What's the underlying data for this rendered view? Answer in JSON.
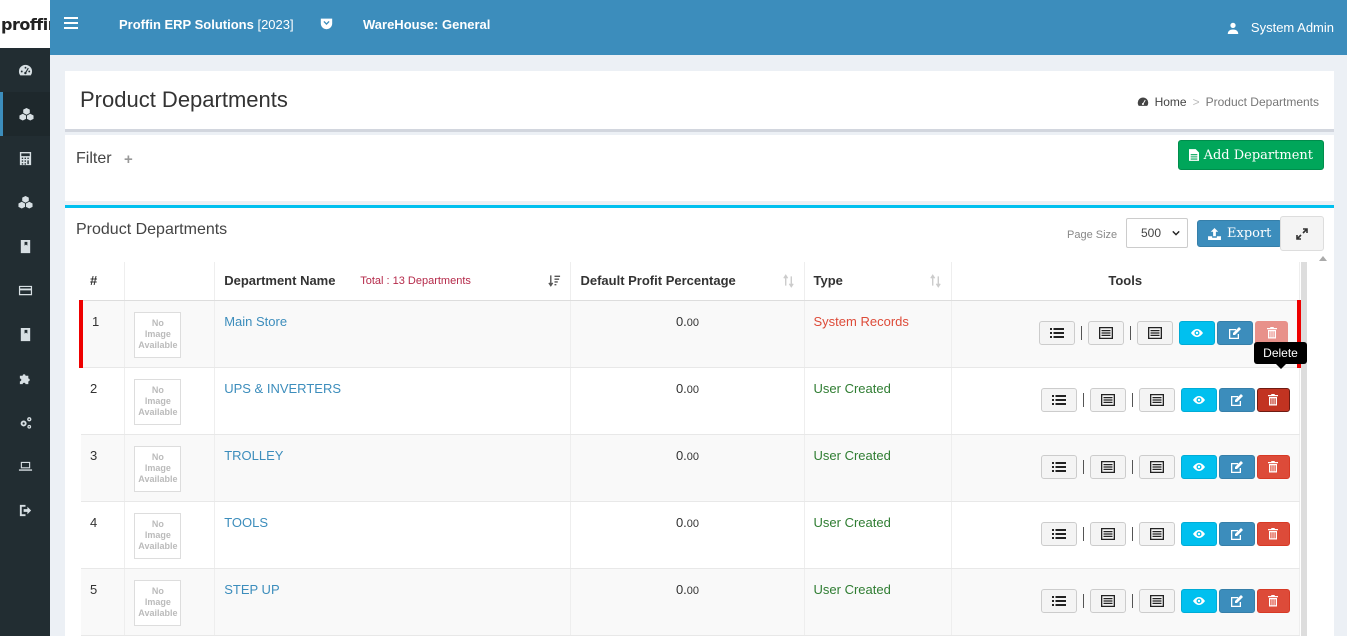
{
  "app": {
    "logo_text": "proffin",
    "company_name": "Proffin ERP Solutions",
    "company_year": "[2023]",
    "warehouse": "WareHouse: General",
    "user": "System Admin"
  },
  "sidebar": {
    "items": [
      {
        "icon": "dashboard-icon"
      },
      {
        "icon": "cubes-icon",
        "active": true
      },
      {
        "icon": "calculator-icon"
      },
      {
        "icon": "cubes-icon"
      },
      {
        "icon": "book-icon"
      },
      {
        "icon": "credit-card-icon"
      },
      {
        "icon": "book-icon"
      },
      {
        "icon": "puzzle-icon"
      },
      {
        "icon": "cogs-icon"
      },
      {
        "icon": "laptop-icon"
      },
      {
        "icon": "sign-out-icon"
      }
    ]
  },
  "header": {
    "title": "Product Departments",
    "breadcrumb_home": "Home",
    "breadcrumb_sep": ">",
    "breadcrumb_current": "Product Departments"
  },
  "filter": {
    "title": "Filter",
    "plus": "+",
    "add_button": "Add Department"
  },
  "list": {
    "title": "Product Departments",
    "page_size_label": "Page Size",
    "page_size_value": "500",
    "export_button": "Export",
    "tooltip": "Delete"
  },
  "table": {
    "headers": {
      "num": "#",
      "image": "",
      "name": "Department Name",
      "total": "Total : 13 Departments",
      "profit": "Default Profit Percentage",
      "type": "Type",
      "tools": "Tools"
    },
    "no_image": [
      "No",
      "Image",
      "Available"
    ],
    "rows": [
      {
        "num": "1",
        "name": "Main Store",
        "pct_int": "0.",
        "pct_dec": "00",
        "type": "System Records",
        "system": true
      },
      {
        "num": "2",
        "name": "UPS & INVERTERS",
        "pct_int": "0.",
        "pct_dec": "00",
        "type": "User Created",
        "system": false
      },
      {
        "num": "3",
        "name": "TROLLEY",
        "pct_int": "0.",
        "pct_dec": "00",
        "type": "User Created",
        "system": false
      },
      {
        "num": "4",
        "name": "TOOLS",
        "pct_int": "0.",
        "pct_dec": "00",
        "type": "User Created",
        "system": false
      },
      {
        "num": "5",
        "name": "STEP UP",
        "pct_int": "0.",
        "pct_dec": "00",
        "type": "User Created",
        "system": false
      }
    ]
  },
  "colors": {
    "topbar": "#3c8dbc",
    "sidebar": "#222d32",
    "success": "#00a65a",
    "info": "#00c0ef",
    "danger": "#dd4b39"
  }
}
